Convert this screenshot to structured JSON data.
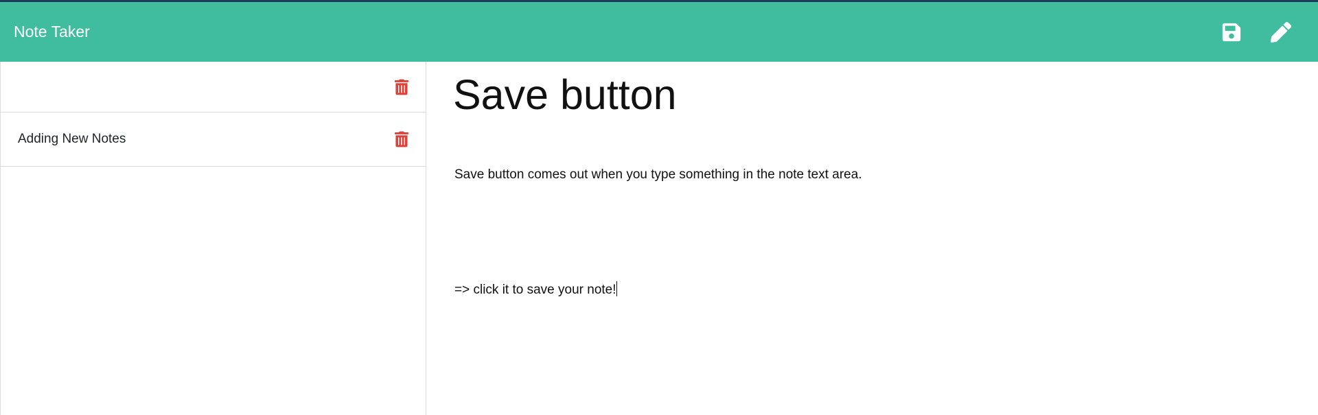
{
  "app": {
    "title": "Note Taker"
  },
  "toolbar": {
    "save_icon": "save-icon",
    "new_note_icon": "pencil-icon"
  },
  "sidebar": {
    "notes": [
      {
        "title": ""
      },
      {
        "title": "Adding New Notes"
      }
    ]
  },
  "editor": {
    "title": "Save button",
    "body_line_1": "Save button comes out when you type something in the note text area.",
    "body_line_2": "=> click it to save your note!"
  },
  "colors": {
    "navbar": "#3fbd9e",
    "delete": "#d9433a"
  }
}
